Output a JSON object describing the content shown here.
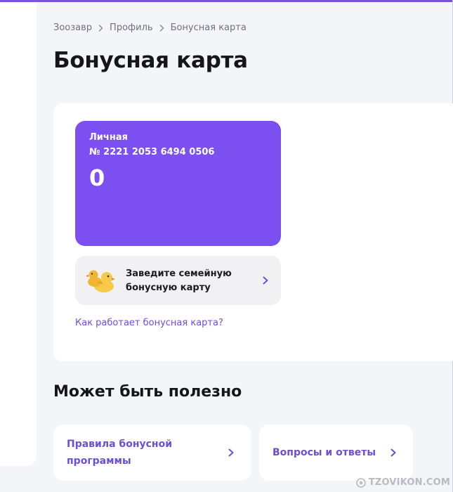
{
  "breadcrumb": {
    "items": [
      "Зоозавр",
      "Профиль",
      "Бонусная карта"
    ]
  },
  "page_title": "Бонусная карта",
  "bonus_card": {
    "type_label": "Личная",
    "number": "№ 2221 2053 6494 0506",
    "balance": "0",
    "color": "#7b4ff0"
  },
  "family_banner": {
    "text": "Заведите семейную бонусную карту",
    "icon": "duck-icon"
  },
  "how_link": "Как работает бонусная карта?",
  "useful": {
    "title": "Может быть полезно",
    "cards": [
      {
        "label": "Правила бонусной программы",
        "icon": "chevron-right-icon"
      },
      {
        "label": "Вопросы и ответы",
        "icon": "chevron-right-icon"
      }
    ]
  },
  "watermark": "TZOVIKON.COM",
  "colors": {
    "accent": "#7b4ff0",
    "link": "#6b4fd8",
    "background": "#f4f5f9"
  }
}
